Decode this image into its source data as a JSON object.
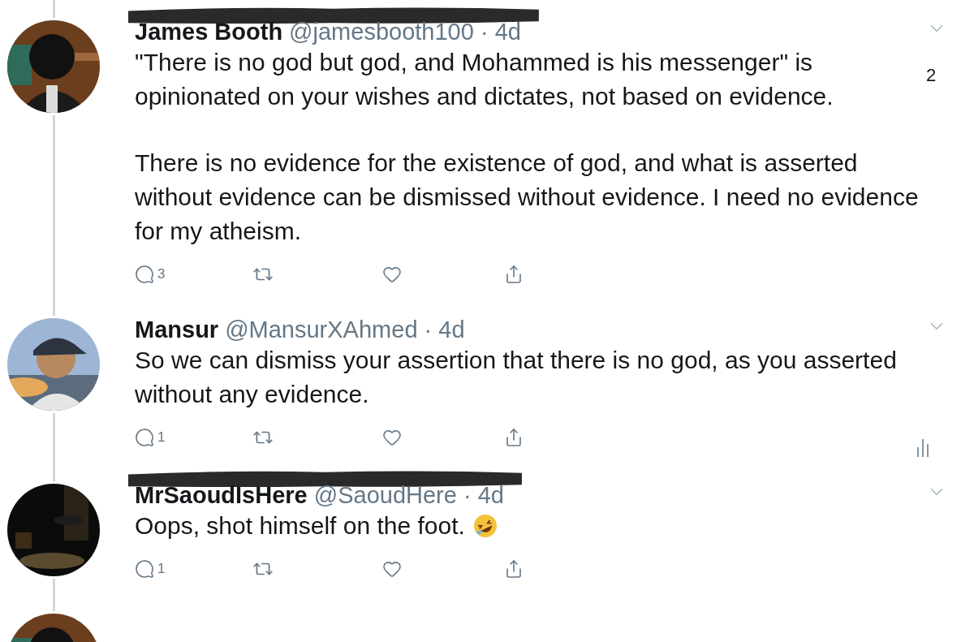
{
  "tweets": [
    {
      "name": "James Booth",
      "meta": "@jamesbooth100 · 4d",
      "redacted": true,
      "side_count": "2",
      "paragraphs": [
        "\"There is no god but god, and Mohammed is his messenger\" is opinionated on your wishes and dictates, not based on evidence.",
        "There is no evidence for the existence of god, and what is asserted without evidence can be dismissed without evidence. I need no evidence for my atheism."
      ],
      "emoji": false,
      "reply_count": "3",
      "analytics": false
    },
    {
      "name": "Mansur",
      "meta": "@MansurXAhmed · 4d",
      "redacted": false,
      "paragraphs": [
        "So we can dismiss your assertion that there is no god, as you asserted without any evidence."
      ],
      "emoji": false,
      "reply_count": "1",
      "analytics": true
    },
    {
      "name": "MrSaoudIsHere",
      "meta": "@SaoudHere · 4d",
      "redacted": true,
      "paragraphs": [
        "Oops, shot himself on the foot."
      ],
      "emoji": true,
      "reply_count": "1",
      "analytics": false
    }
  ]
}
